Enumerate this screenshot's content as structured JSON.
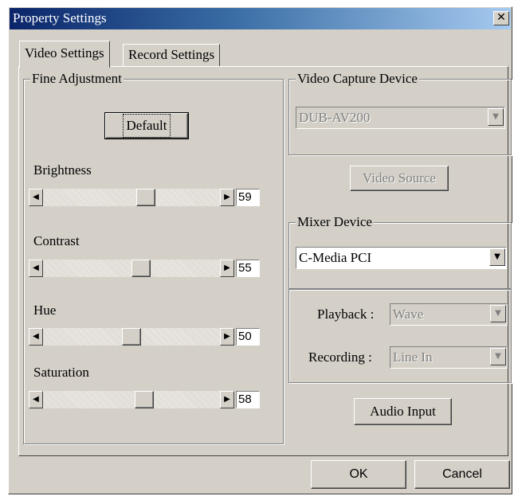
{
  "window": {
    "title": "Property Settings",
    "close_symbol": "✕"
  },
  "tabs": [
    {
      "label": "Video Settings",
      "active": true
    },
    {
      "label": "Record Settings",
      "active": false
    }
  ],
  "fine_adjustment": {
    "label": "Fine Adjustment",
    "default_button": "Default",
    "sliders": [
      {
        "label": "Brightness",
        "value": "59"
      },
      {
        "label": "Contrast",
        "value": "55"
      },
      {
        "label": "Hue",
        "value": "50"
      },
      {
        "label": "Saturation",
        "value": "58"
      }
    ]
  },
  "video_capture": {
    "label": "Video Capture Device",
    "device": "DUB-AV200",
    "source_button": "Video Source"
  },
  "mixer": {
    "label": "Mixer Device",
    "device": "C-Media PCI"
  },
  "audio": {
    "playback_label": "Playback :",
    "playback_value": "Wave",
    "recording_label": "Recording :",
    "recording_value": "Line In",
    "input_button": "Audio Input"
  },
  "footer": {
    "ok_label": "OK",
    "cancel_label": "Cancel"
  },
  "icons": {
    "left_arrow": "◀",
    "right_arrow": "▶",
    "down_arrow": "▼"
  },
  "colors": {
    "face": "#d4d0c8",
    "title_start": "#0a246a",
    "title_end": "#a6caf0"
  }
}
